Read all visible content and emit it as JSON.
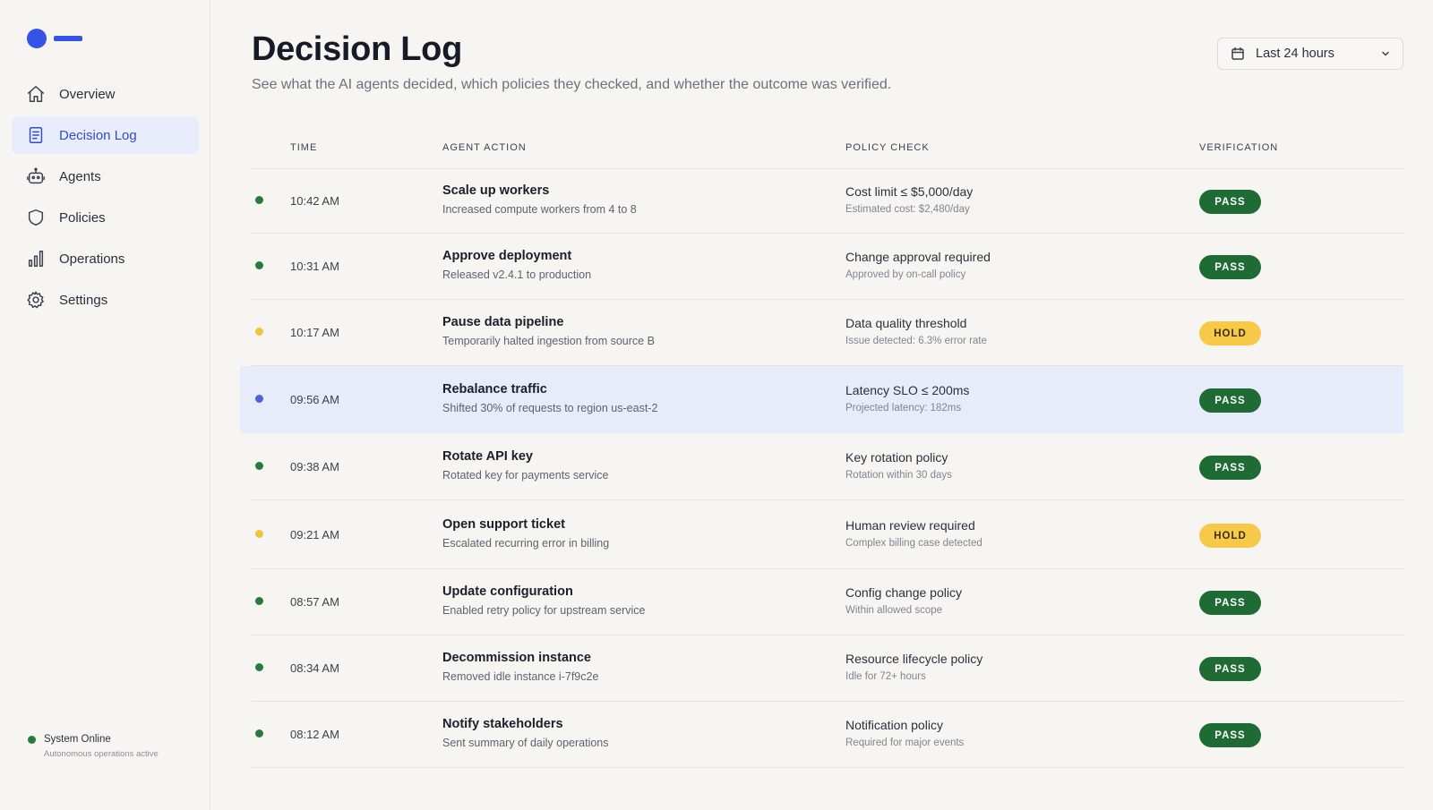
{
  "colors": {
    "accent": "#3354e6",
    "pass": "#1f6b34",
    "hold": "#f7c948",
    "dot_green": "#2b7a3d",
    "dot_yellow": "#f2c23c",
    "dot_blue": "#4c63d9"
  },
  "sidebar": {
    "items": [
      {
        "label": "Overview",
        "icon": "home-icon"
      },
      {
        "label": "Decision Log",
        "icon": "document-icon"
      },
      {
        "label": "Agents",
        "icon": "robot-icon"
      },
      {
        "label": "Policies",
        "icon": "shield-icon"
      },
      {
        "label": "Operations",
        "icon": "bar-chart-icon"
      },
      {
        "label": "Settings",
        "icon": "gear-icon"
      }
    ],
    "active_index": 1,
    "status": {
      "title": "System Online",
      "subtitle": "Autonomous operations active"
    }
  },
  "header": {
    "title": "Decision Log",
    "subtitle": "See what the AI agents decided, which policies they checked, and whether the outcome was verified.",
    "range_label": "Last 24 hours"
  },
  "table": {
    "columns": {
      "time": "TIME",
      "action": "AGENT ACTION",
      "policy": "POLICY CHECK",
      "verification": "VERIFICATION"
    },
    "rows": [
      {
        "status": "green",
        "time": "10:42 AM",
        "action_title": "Scale up workers",
        "action_sub": "Increased compute workers from 4 to 8",
        "policy_title": "Cost limit ≤ $5,000/day",
        "policy_sub": "Estimated cost: $2,480/day",
        "verification": "PASS"
      },
      {
        "status": "green",
        "time": "10:31 AM",
        "action_title": "Approve deployment",
        "action_sub": "Released v2.4.1 to production",
        "policy_title": "Change approval required",
        "policy_sub": "Approved by on-call policy",
        "verification": "PASS"
      },
      {
        "status": "yellow",
        "time": "10:17 AM",
        "action_title": "Pause data pipeline",
        "action_sub": "Temporarily halted ingestion from source B",
        "policy_title": "Data quality threshold",
        "policy_sub": "Issue detected: 6.3% error rate",
        "verification": "HOLD"
      },
      {
        "status": "blue",
        "time": "09:56 AM",
        "action_title": "Rebalance traffic",
        "action_sub": "Shifted 30% of requests to region us-east-2",
        "policy_title": "Latency SLO ≤ 200ms",
        "policy_sub": "Projected latency: 182ms",
        "verification": "PASS",
        "selected": true
      },
      {
        "status": "green",
        "time": "09:38 AM",
        "action_title": "Rotate API key",
        "action_sub": "Rotated key for payments service",
        "policy_title": "Key rotation policy",
        "policy_sub": "Rotation within 30 days",
        "verification": "PASS"
      },
      {
        "status": "yellow",
        "time": "09:21 AM",
        "action_title": "Open support ticket",
        "action_sub": "Escalated recurring error in billing",
        "policy_title": "Human review required",
        "policy_sub": "Complex billing case detected",
        "verification": "HOLD"
      },
      {
        "status": "green",
        "time": "08:57 AM",
        "action_title": "Update configuration",
        "action_sub": "Enabled retry policy for upstream service",
        "policy_title": "Config change policy",
        "policy_sub": "Within allowed scope",
        "verification": "PASS"
      },
      {
        "status": "green",
        "time": "08:34 AM",
        "action_title": "Decommission instance",
        "action_sub": "Removed idle instance i-7f9c2e",
        "policy_title": "Resource lifecycle policy",
        "policy_sub": "Idle for 72+ hours",
        "verification": "PASS"
      },
      {
        "status": "green",
        "time": "08:12 AM",
        "action_title": "Notify stakeholders",
        "action_sub": "Sent summary of daily operations",
        "policy_title": "Notification policy",
        "policy_sub": "Required for major events",
        "verification": "PASS"
      }
    ]
  }
}
